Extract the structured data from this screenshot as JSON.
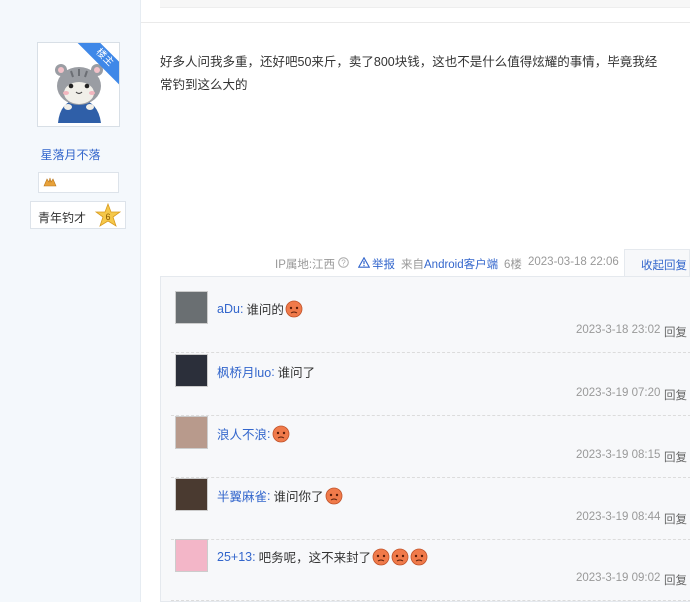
{
  "author": {
    "badge": "楼主",
    "name": "星落月不落",
    "level_title": "青年钓才",
    "level_num": "6"
  },
  "post": {
    "line1": "好多人问我多重，还好吧50来斤，卖了800块钱，这也不是什么值得炫耀的事情，毕竟我经",
    "line2": "常钓到这么大的",
    "ip": "IP属地:江西",
    "report": "举报",
    "client": "来自Android客户端",
    "floor": "6楼",
    "datetime": "2023-03-18 22:06",
    "collapse": "收起回复"
  },
  "replies": [
    {
      "name": "aDu",
      "colon": ":",
      "content": "谁问的",
      "emoji_count": 1,
      "time": "2023-3-18 23:02",
      "reply": "回复",
      "avatar_color": "#6a6f72"
    },
    {
      "name": "枫桥月luo",
      "colon": ":",
      "content": "谁问了",
      "emoji_count": 0,
      "time": "2023-3-19 07:20",
      "reply": "回复",
      "avatar_color": "#2b2f3a"
    },
    {
      "name": "浪人不浪",
      "colon": ":",
      "content": "",
      "emoji_count": 1,
      "time": "2023-3-19 08:15",
      "reply": "回复",
      "avatar_color": "#b89a8c"
    },
    {
      "name": "半翼麻雀",
      "colon": ":",
      "content": "谁问你了",
      "emoji_count": 1,
      "time": "2023-3-19 08:44",
      "reply": "回复",
      "avatar_color": "#4a3a30"
    },
    {
      "name": "25+13",
      "colon": ":",
      "content": "吧务呢，这不来封了",
      "emoji_count": 3,
      "time": "2023-3-19 09:02",
      "reply": "回复",
      "avatar_color": "#f3b6c8"
    }
  ],
  "colors": {
    "link": "#3366cc",
    "ribbon": "#3f88e8",
    "emoji": "#f07a4a"
  }
}
